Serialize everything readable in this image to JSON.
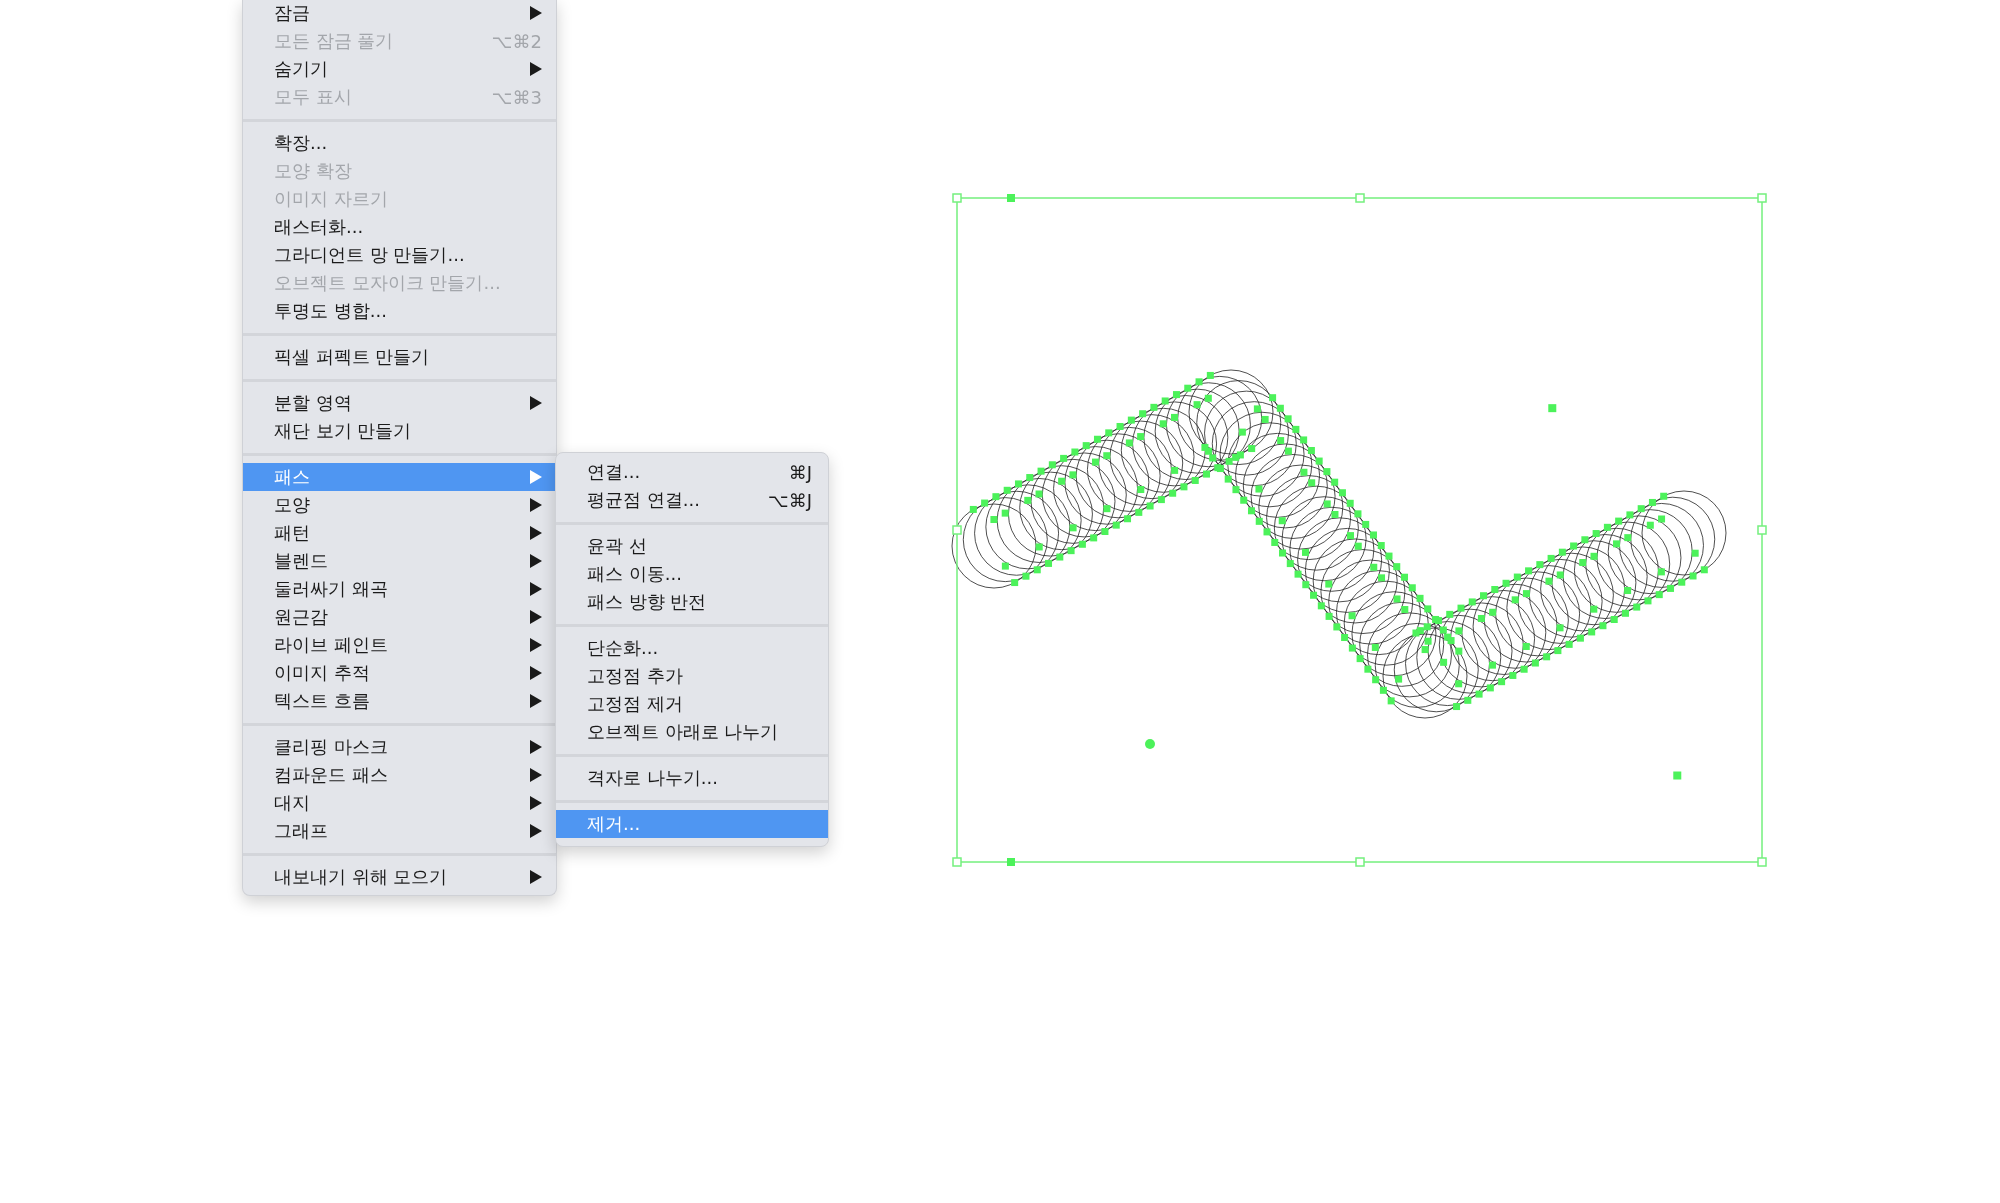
{
  "object_menu": {
    "items": [
      {
        "kind": "item",
        "label": "잠금",
        "submenu": true,
        "disabled": false,
        "selected": false
      },
      {
        "kind": "item",
        "label": "모든 잠금 풀기",
        "shortcut": "⌥⌘2",
        "disabled": true,
        "selected": false
      },
      {
        "kind": "item",
        "label": "숨기기",
        "submenu": true,
        "disabled": false,
        "selected": false
      },
      {
        "kind": "item",
        "label": "모두 표시",
        "shortcut": "⌥⌘3",
        "disabled": true,
        "selected": false
      },
      {
        "kind": "separator"
      },
      {
        "kind": "item",
        "label": "확장...",
        "disabled": false,
        "selected": false
      },
      {
        "kind": "item",
        "label": "모양 확장",
        "disabled": true,
        "selected": false
      },
      {
        "kind": "item",
        "label": "이미지 자르기",
        "disabled": true,
        "selected": false
      },
      {
        "kind": "item",
        "label": "래스터화...",
        "disabled": false,
        "selected": false
      },
      {
        "kind": "item",
        "label": "그라디언트 망 만들기...",
        "disabled": false,
        "selected": false
      },
      {
        "kind": "item",
        "label": "오브젝트 모자이크 만들기...",
        "disabled": true,
        "selected": false
      },
      {
        "kind": "item",
        "label": "투명도 병합...",
        "disabled": false,
        "selected": false
      },
      {
        "kind": "separator"
      },
      {
        "kind": "item",
        "label": "픽셀 퍼펙트 만들기",
        "disabled": false,
        "selected": false
      },
      {
        "kind": "separator"
      },
      {
        "kind": "item",
        "label": "분할 영역",
        "submenu": true,
        "disabled": false,
        "selected": false
      },
      {
        "kind": "item",
        "label": "재단 보기 만들기",
        "disabled": false,
        "selected": false
      },
      {
        "kind": "separator"
      },
      {
        "kind": "item",
        "label": "패스",
        "submenu": true,
        "disabled": false,
        "selected": true
      },
      {
        "kind": "item",
        "label": "모양",
        "submenu": true,
        "disabled": false,
        "selected": false
      },
      {
        "kind": "item",
        "label": "패턴",
        "submenu": true,
        "disabled": false,
        "selected": false
      },
      {
        "kind": "item",
        "label": "블렌드",
        "submenu": true,
        "disabled": false,
        "selected": false
      },
      {
        "kind": "item",
        "label": "둘러싸기 왜곡",
        "submenu": true,
        "disabled": false,
        "selected": false
      },
      {
        "kind": "item",
        "label": "원근감",
        "submenu": true,
        "disabled": false,
        "selected": false
      },
      {
        "kind": "item",
        "label": "라이브 페인트",
        "submenu": true,
        "disabled": false,
        "selected": false
      },
      {
        "kind": "item",
        "label": "이미지 추적",
        "submenu": true,
        "disabled": false,
        "selected": false
      },
      {
        "kind": "item",
        "label": "텍스트 흐름",
        "submenu": true,
        "disabled": false,
        "selected": false
      },
      {
        "kind": "separator"
      },
      {
        "kind": "item",
        "label": "클리핑 마스크",
        "submenu": true,
        "disabled": false,
        "selected": false
      },
      {
        "kind": "item",
        "label": "컴파운드 패스",
        "submenu": true,
        "disabled": false,
        "selected": false
      },
      {
        "kind": "item",
        "label": "대지",
        "submenu": true,
        "disabled": false,
        "selected": false
      },
      {
        "kind": "item",
        "label": "그래프",
        "submenu": true,
        "disabled": false,
        "selected": false
      },
      {
        "kind": "separator"
      },
      {
        "kind": "item",
        "label": "내보내기 위해 모으기",
        "submenu": true,
        "disabled": false,
        "selected": false
      }
    ]
  },
  "path_submenu": {
    "items": [
      {
        "kind": "item",
        "label": "연결...",
        "shortcut": "⌘J",
        "selected": false
      },
      {
        "kind": "item",
        "label": "평균점 연결...",
        "shortcut": "⌥⌘J",
        "selected": false
      },
      {
        "kind": "separator"
      },
      {
        "kind": "item",
        "label": "윤곽 선",
        "selected": false
      },
      {
        "kind": "item",
        "label": "패스 이동...",
        "selected": false
      },
      {
        "kind": "item",
        "label": "패스 방향 반전",
        "selected": false
      },
      {
        "kind": "separator"
      },
      {
        "kind": "item",
        "label": "단순화...",
        "selected": false
      },
      {
        "kind": "item",
        "label": "고정점 추가",
        "selected": false
      },
      {
        "kind": "item",
        "label": "고정점 제거",
        "selected": false
      },
      {
        "kind": "item",
        "label": "오브젝트 아래로 나누기",
        "selected": false
      },
      {
        "kind": "separator"
      },
      {
        "kind": "item",
        "label": "격자로 나누기...",
        "selected": false
      },
      {
        "kind": "separator"
      },
      {
        "kind": "item",
        "label": "제거...",
        "selected": true
      }
    ]
  }
}
